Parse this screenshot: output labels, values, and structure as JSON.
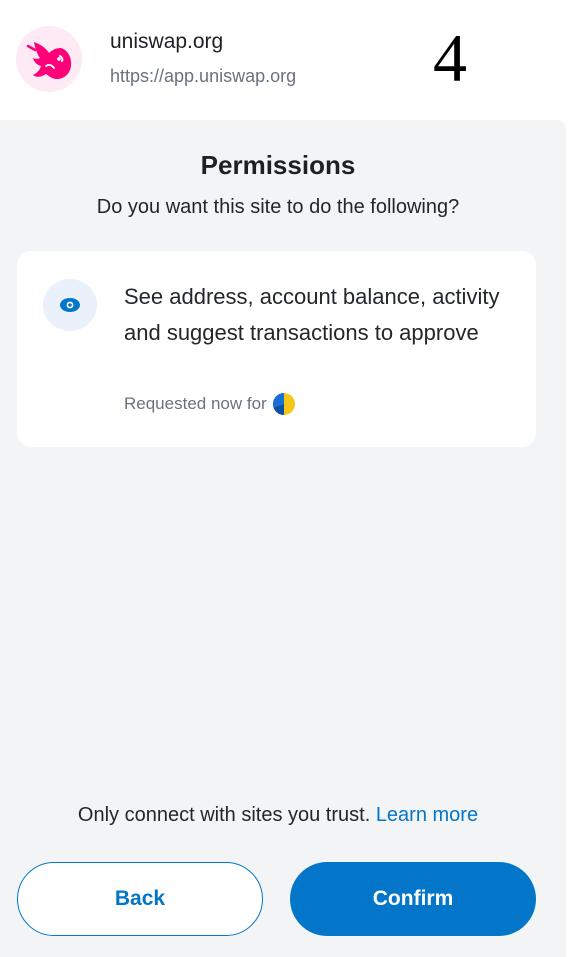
{
  "site": {
    "name": "uniswap.org",
    "url": "https://app.uniswap.org",
    "logo_icon": "uniswap-unicorn-icon"
  },
  "step_number": "4",
  "permissions": {
    "title": "Permissions",
    "subtitle": "Do you want this site to do the following?",
    "items": [
      {
        "icon": "eye-icon",
        "text": "See address, account balance, activity and suggest transactions to approve",
        "requested": "Requested now for"
      }
    ]
  },
  "footer": {
    "trust_text": "Only connect with sites you trust.",
    "learn_more": "Learn more",
    "back_label": "Back",
    "confirm_label": "Confirm"
  },
  "colors": {
    "accent": "#0376c9",
    "logo_pink": "#ff007a",
    "background": "#f2f4f6"
  }
}
